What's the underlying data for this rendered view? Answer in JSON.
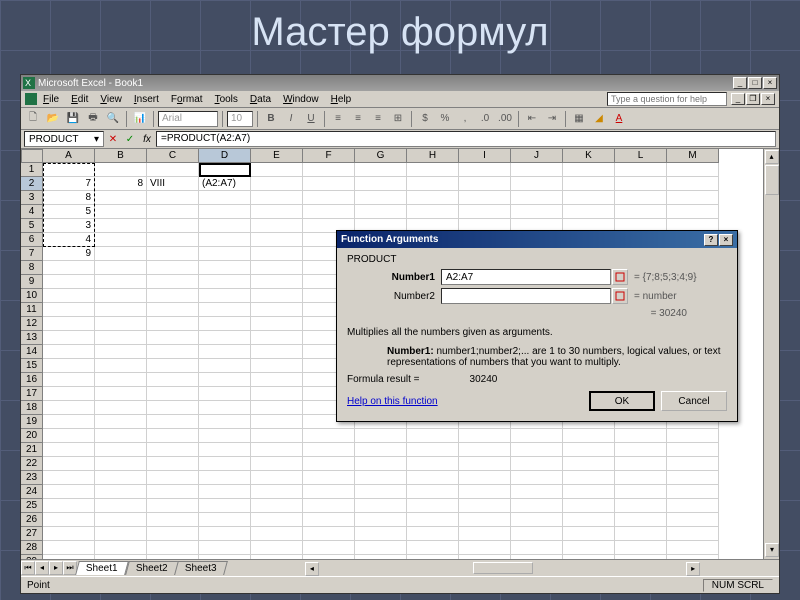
{
  "slide": {
    "title": "Мастер формул"
  },
  "window": {
    "title": "Microsoft Excel - Book1",
    "help_placeholder": "Type a question for help"
  },
  "menu": {
    "file": "File",
    "edit": "Edit",
    "view": "View",
    "insert": "Insert",
    "format": "Format",
    "tools": "Tools",
    "data": "Data",
    "window": "Window",
    "help": "Help"
  },
  "toolbar": {
    "font": "Arial",
    "size": "10"
  },
  "formula_bar": {
    "name_box": "PRODUCT",
    "cancel": "✕",
    "enter": "✓",
    "fx": "fx",
    "formula": "=PRODUCT(A2:A7)"
  },
  "columns": [
    "A",
    "B",
    "C",
    "D",
    "E",
    "F",
    "G",
    "H",
    "I",
    "J",
    "K",
    "L",
    "M"
  ],
  "active_col": "D",
  "active_row": 2,
  "cells": {
    "A2": "7",
    "A3": "8",
    "A4": "5",
    "A5": "3",
    "A6": "4",
    "A7": "9",
    "B2": "8",
    "C2": "VIII",
    "D2": "(A2:A7)"
  },
  "sheets": {
    "s1": "Sheet1",
    "s2": "Sheet2",
    "s3": "Sheet3"
  },
  "status": {
    "left": "Point",
    "right": "NUM SCRL"
  },
  "dialog": {
    "title": "Function Arguments",
    "func": "PRODUCT",
    "arg1_label": "Number1",
    "arg1_value": "A2:A7",
    "arg1_eval": "= {7;8;5;3;4;9}",
    "arg2_label": "Number2",
    "arg2_value": "",
    "arg2_eval": "= number",
    "calc_result": "= 30240",
    "desc": "Multiplies all the numbers given as arguments.",
    "arg_desc_lead": "Number1:",
    "arg_desc_text": " number1;number2;... are 1 to 30 numbers, logical values, or text representations of numbers that you want to multiply.",
    "result_label": "Formula result =",
    "result_value": "30240",
    "help_link": "Help on this function",
    "ok": "OK",
    "cancel": "Cancel"
  },
  "chart_data": null
}
